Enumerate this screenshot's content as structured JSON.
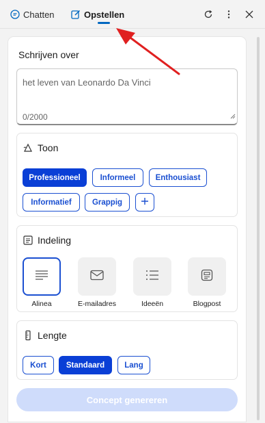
{
  "tabs": [
    {
      "label": "Chatten",
      "icon": "chat-icon"
    },
    {
      "label": "Opstellen",
      "icon": "compose-icon",
      "active": true
    }
  ],
  "toolbar": {
    "refresh_icon": "refresh-icon",
    "more_icon": "more-icon",
    "close_icon": "close-icon"
  },
  "compose": {
    "label": "Schrijven over",
    "input_value": "het leven van Leonardo Da Vinci",
    "char_count": "0/2000"
  },
  "tone": {
    "title": "Toon",
    "icon": "tone-icon",
    "options": [
      "Professioneel",
      "Informeel",
      "Enthousiast",
      "Informatief",
      "Grappig"
    ],
    "selected": "Professioneel",
    "add_icon": "plus-icon"
  },
  "format": {
    "title": "Indeling",
    "icon": "format-icon",
    "options": [
      {
        "label": "Alinea",
        "icon": "paragraph-icon"
      },
      {
        "label": "E-mailadres",
        "icon": "email-icon"
      },
      {
        "label": "Ideeën",
        "icon": "list-icon"
      },
      {
        "label": "Blogpost",
        "icon": "blogpost-icon"
      }
    ],
    "selected": "Alinea"
  },
  "length": {
    "title": "Lengte",
    "icon": "ruler-icon",
    "options": [
      "Kort",
      "Standaard",
      "Lang"
    ],
    "selected": "Standaard"
  },
  "generate_button": {
    "label": "Concept genereren",
    "state": "disabled"
  },
  "colors": {
    "accent": "#0a3fd6",
    "link": "#1a4fd1",
    "annotation_arrow": "#e02020"
  }
}
